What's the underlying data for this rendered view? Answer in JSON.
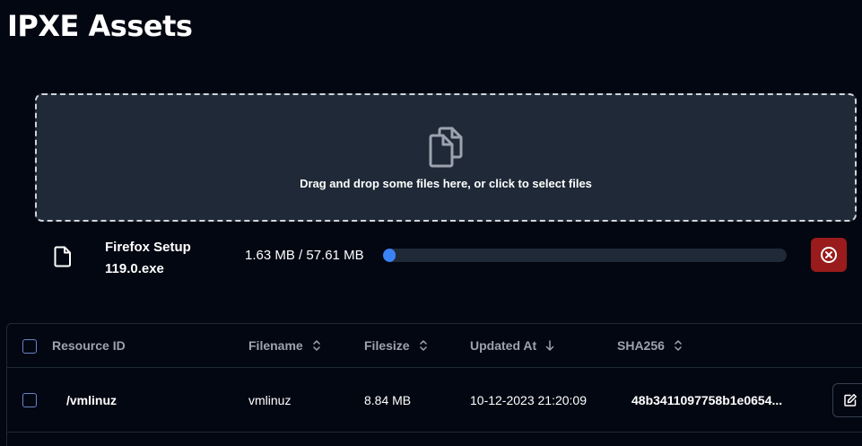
{
  "page": {
    "title": "IPXE Assets"
  },
  "dropzone": {
    "text": "Drag and drop some files here, or click to select files",
    "icon": "copy-files-icon"
  },
  "upload": {
    "file_name": "Firefox Setup 119.0.exe",
    "progress_text": "1.63 MB / 57.61 MB",
    "progress_fraction": 0.028,
    "file_icon": "file-icon",
    "cancel_icon": "close-circle-icon"
  },
  "table": {
    "columns": [
      {
        "label": "Resource ID",
        "sort": "none-shown"
      },
      {
        "label": "Filename",
        "sort": "unsorted"
      },
      {
        "label": "Filesize",
        "sort": "unsorted"
      },
      {
        "label": "Updated At",
        "sort": "descending"
      },
      {
        "label": "SHA256",
        "sort": "unsorted"
      }
    ],
    "rows": [
      {
        "resource_id": "/vmlinuz",
        "filename": "vmlinuz",
        "filesize": "8.84 MB",
        "updated_at": "10-12-2023 21:20:09",
        "sha256": "48b3411097758b1e0654...",
        "action_icon": "edit-icon"
      }
    ]
  },
  "colors": {
    "background": "#030712",
    "panel": "#1f2937",
    "accent": "#3b82f6",
    "danger": "#991b1b",
    "muted_text": "#9ca3af"
  }
}
